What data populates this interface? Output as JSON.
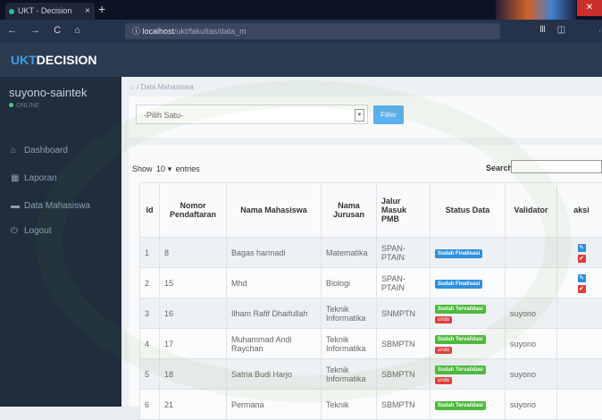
{
  "browser": {
    "tab_title": "UKT - Decision",
    "tab_close": "×",
    "new_tab": "+",
    "nav_glyphs": "← → C ⌂",
    "url_host": "localhost",
    "url_path": "/ukt/fakultas/data_m",
    "url_icons": "··· ♡",
    "star_icon": "★",
    "right_icons": "Ⅲ ◫",
    "window_close": "✕"
  },
  "app": {
    "brand_prefix": "UKT",
    "brand_suffix": "DECISION"
  },
  "sidebar": {
    "user": "suyono-saintek",
    "status": "ONLINE",
    "items": [
      {
        "label": "Dashboard",
        "icon": "⌂"
      },
      {
        "label": "Laporan",
        "icon": "▦"
      },
      {
        "label": "Data Mahasiswa",
        "icon": "▬"
      },
      {
        "label": "Logout",
        "icon": "⏻"
      }
    ]
  },
  "breadcrumb": {
    "home_icon": "⌂",
    "label": "Data Mahasiswa"
  },
  "filter": {
    "select_value": "-Pilih Satu-",
    "select_caret": "▾",
    "button": "Filter"
  },
  "table": {
    "show_prefix": "Show",
    "show_value": "10",
    "show_caret": "▾",
    "show_suffix": "entries",
    "search_label": "Search:",
    "headers": [
      "Id",
      "Nomor Pendaftaran",
      "Nama Mahasiswa",
      "Nama Jurusan",
      "Jalur Masuk PMB",
      "Status Data",
      "Validator",
      "aksi"
    ],
    "rows": [
      {
        "id": "1",
        "nomor": "8",
        "nama": "Bagas harmadi",
        "jurusan": "Matematika",
        "jalur": "SPAN-PTAIN",
        "status": "Sudah Finalisasi",
        "undo": "",
        "validator": "",
        "edit": "✎",
        "check": "✔"
      },
      {
        "id": "2",
        "nomor": "15",
        "nama": "Mhd",
        "jurusan": "Biologi",
        "jalur": "SPAN-PTAIN",
        "status": "Sudah Finalisasi",
        "undo": "",
        "validator": "",
        "edit": "✎",
        "check": "✔"
      },
      {
        "id": "3",
        "nomor": "16",
        "nama": "Ilham Rafif Dhaifullah",
        "jurusan": "Teknik Informatika",
        "jalur": "SNMPTN",
        "status": "Sudah Tervalidasi",
        "undo": "undo",
        "validator": "suyono",
        "edit": "",
        "check": ""
      },
      {
        "id": "4",
        "nomor": "17",
        "nama": "Muhammad Andi Raychan",
        "jurusan": "Teknik Informatika",
        "jalur": "SBMPTN",
        "status": "Sudah Tervalidasi",
        "undo": "undo",
        "validator": "suyono",
        "edit": "",
        "check": ""
      },
      {
        "id": "5",
        "nomor": "18",
        "nama": "Satria Budi Harjo",
        "jurusan": "Teknik Informatika",
        "jalur": "SBMPTN",
        "status": "Sudah Tervalidasi",
        "undo": "undo",
        "validator": "suyono",
        "edit": "",
        "check": ""
      },
      {
        "id": "6",
        "nomor": "21",
        "nama": "Permana",
        "jurusan": "Teknik",
        "jalur": "SBMPTN",
        "status": "Sudah Tervalidasi",
        "undo": "",
        "validator": "suyono",
        "edit": "",
        "check": ""
      }
    ]
  }
}
